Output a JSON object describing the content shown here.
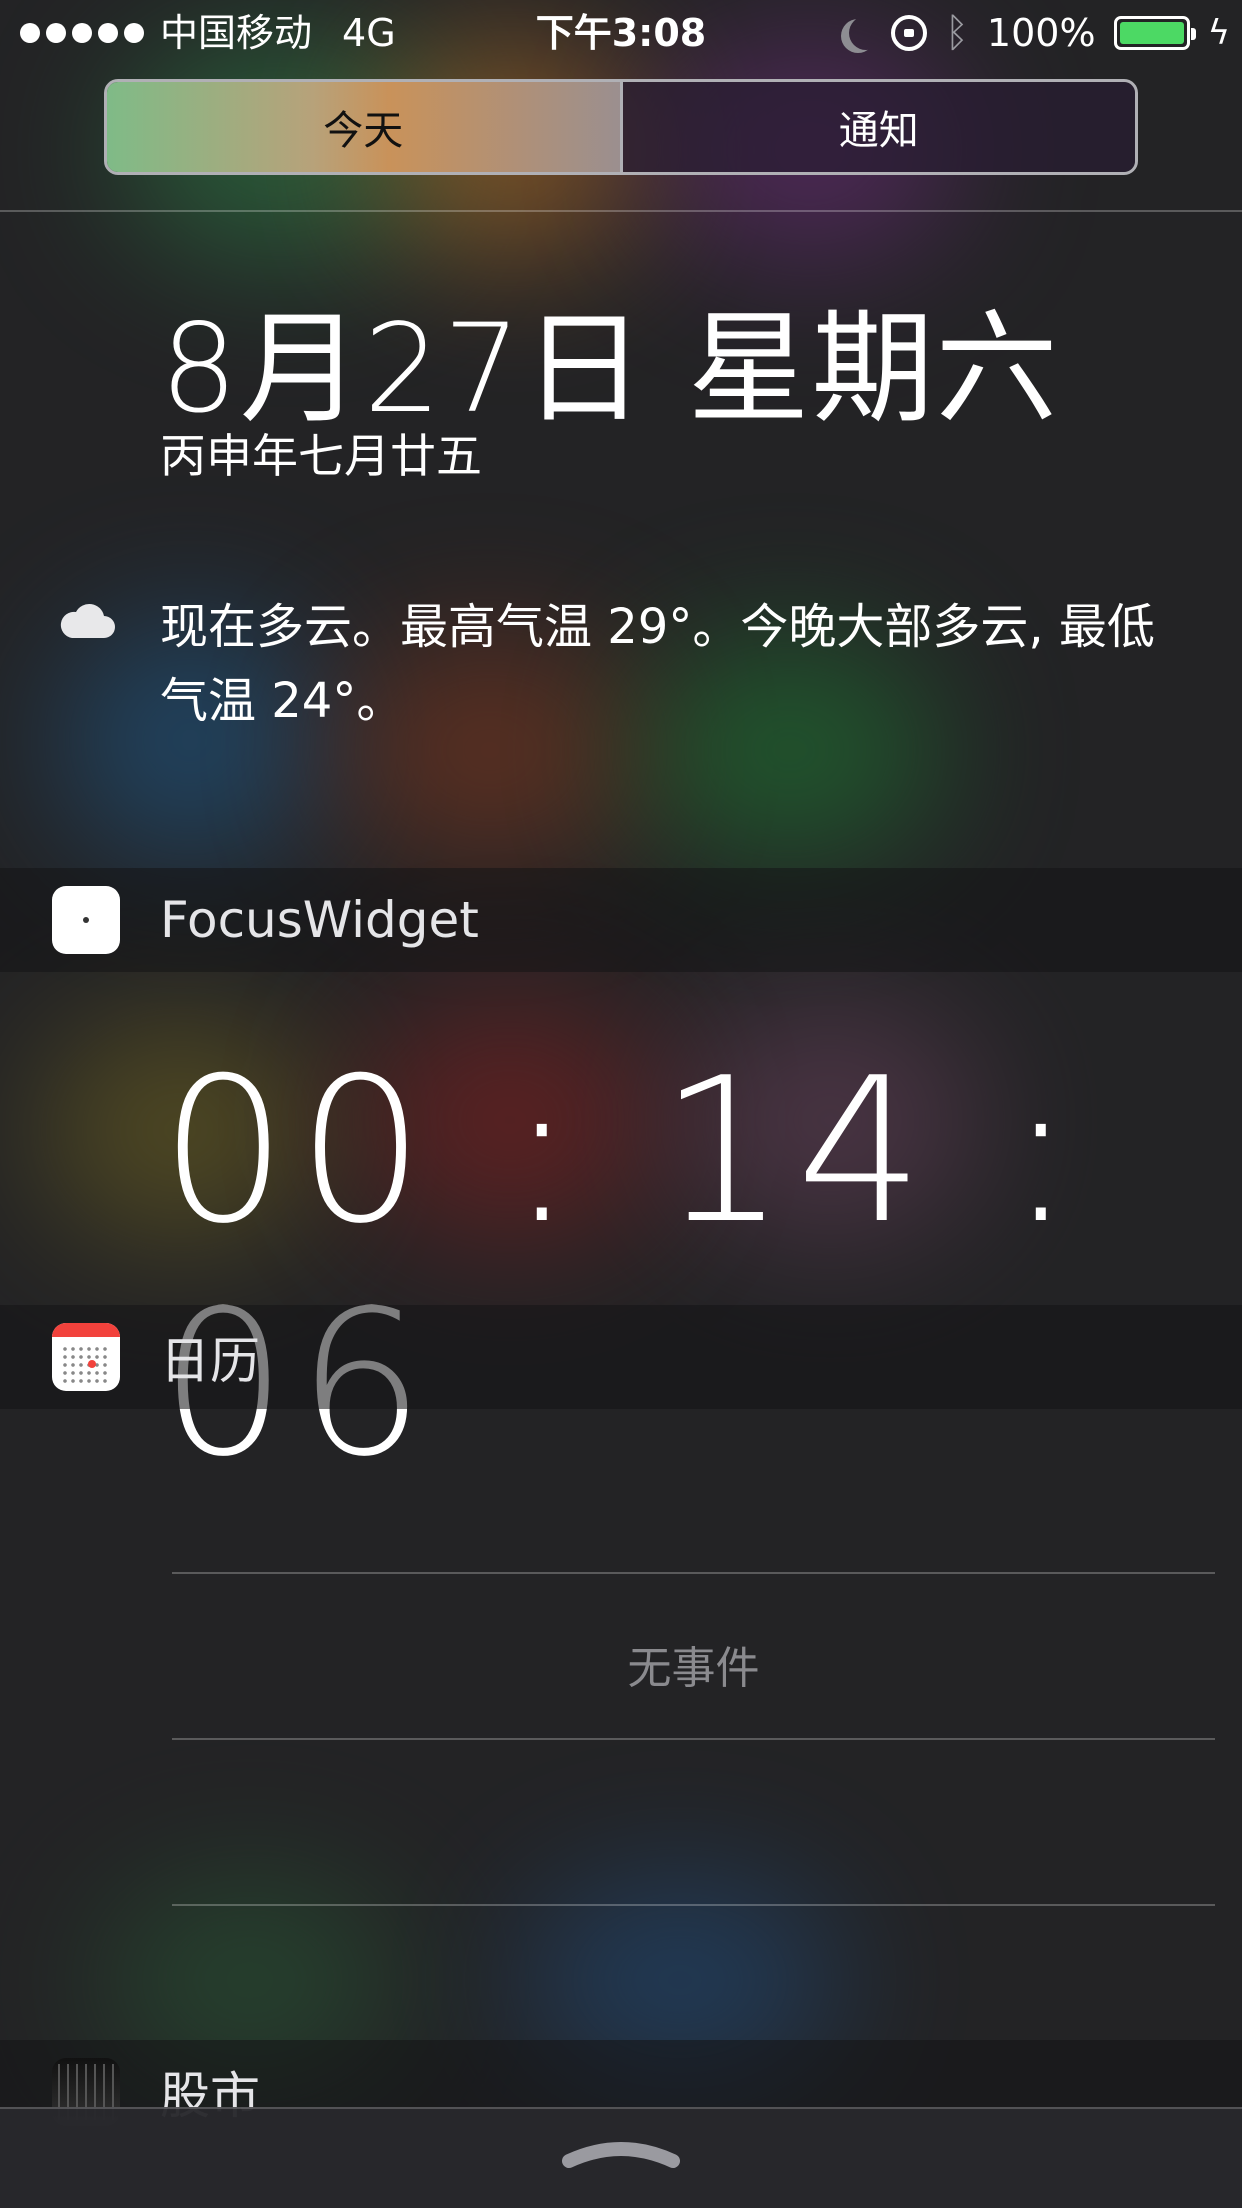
{
  "status_bar": {
    "carrier": "中国移动",
    "network": "4G",
    "time": "下午3:08",
    "battery_percent": "100%",
    "battery_level": 1.0,
    "icons": [
      "signal-dots",
      "moon-icon",
      "rotation-lock-icon",
      "bluetooth-icon",
      "battery-icon",
      "charging-bolt-icon"
    ]
  },
  "segments": {
    "today": "今天",
    "notifications": "通知",
    "selected": "today"
  },
  "date": {
    "main": "8月27日 星期六",
    "lunar": "丙申年七月廿五"
  },
  "weather": {
    "icon": "cloud-icon",
    "text": "现在多云。最高气温 29°。今晚大部多云, 最低气温 24°。"
  },
  "widgets": {
    "focus": {
      "title": "FocusWidget",
      "timer": "00 : 14 : 06"
    },
    "calendar": {
      "title": "日历",
      "empty_text": "无事件"
    },
    "stocks": {
      "title": "股市"
    }
  },
  "colors": {
    "battery_fill": "#4cd964",
    "calendar_red": "#f2423c"
  }
}
